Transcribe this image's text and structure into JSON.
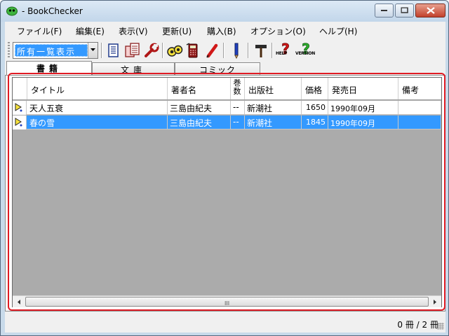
{
  "window": {
    "title": "- BookChecker"
  },
  "menu": [
    {
      "label": "ファイル(F)"
    },
    {
      "label": "編集(E)"
    },
    {
      "label": "表示(V)"
    },
    {
      "label": "更新(U)"
    },
    {
      "label": "購入(B)"
    },
    {
      "label": "オプション(O)"
    },
    {
      "label": "ヘルプ(H)"
    }
  ],
  "toolbar": {
    "view_select": {
      "value": "所有一覧表示"
    },
    "help_label": "HELP",
    "version_label": "VERSION",
    "icons": [
      "list-icon",
      "multi-list-icon",
      "wrench-icon",
      "binoculars-icon",
      "calculator-icon",
      "red-pen-icon",
      "blue-pen-icon",
      "hammer-icon",
      "help-icon",
      "version-icon"
    ]
  },
  "tabs": [
    {
      "label": "書籍"
    },
    {
      "label": "文庫"
    },
    {
      "label": "コミック"
    }
  ],
  "grid": {
    "columns": [
      "タイトル",
      "著者名",
      "巻数",
      "出版社",
      "価格",
      "発売日",
      "備考"
    ],
    "rows": [
      {
        "title": "天人五衰",
        "author": "三島由紀夫",
        "volume": "--",
        "publisher": "新潮社",
        "price": "1650",
        "release": "1990年09月",
        "note": "",
        "selected": false
      },
      {
        "title": "春の雪",
        "author": "三島由紀夫",
        "volume": "--",
        "publisher": "新潮社",
        "price": "1845",
        "release": "1990年09月",
        "note": "",
        "selected": true
      }
    ],
    "scroll_grip": "III"
  },
  "status": {
    "count": "0 冊 / 2 冊"
  },
  "colors": {
    "selection": "#3399ff",
    "highlight_border": "#e01b24",
    "grid_background": "#ababab"
  }
}
